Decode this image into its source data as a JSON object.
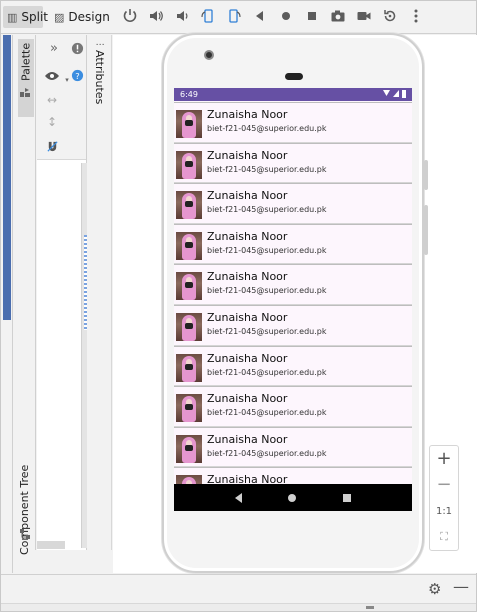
{
  "toolbar": {
    "split_label": "Split",
    "design_label": "Design",
    "tools": [
      "power-icon",
      "volume-up-icon",
      "volume-down-icon",
      "rotate-left-icon",
      "rotate-right-icon",
      "back-icon",
      "home-icon",
      "overview-icon",
      "camera-icon",
      "video-icon",
      "replay-icon",
      "more-icon"
    ]
  },
  "side_tabs": {
    "palette": "Palette",
    "component_tree": "Component Tree",
    "attributes": "Attributes"
  },
  "device": {
    "status_time": "6:49",
    "items": [
      {
        "name": "Zunaisha Noor",
        "email": "biet-f21-045@superior.edu.pk"
      },
      {
        "name": "Zunaisha Noor",
        "email": "biet-f21-045@superior.edu.pk"
      },
      {
        "name": "Zunaisha Noor",
        "email": "biet-f21-045@superior.edu.pk"
      },
      {
        "name": "Zunaisha Noor",
        "email": "biet-f21-045@superior.edu.pk"
      },
      {
        "name": "Zunaisha Noor",
        "email": "biet-f21-045@superior.edu.pk"
      },
      {
        "name": "Zunaisha Noor",
        "email": "biet-f21-045@superior.edu.pk"
      },
      {
        "name": "Zunaisha Noor",
        "email": "biet-f21-045@superior.edu.pk"
      },
      {
        "name": "Zunaisha Noor",
        "email": "biet-f21-045@superior.edu.pk"
      },
      {
        "name": "Zunaisha Noor",
        "email": "biet-f21-045@superior.edu.pk"
      },
      {
        "name": "Zunaisha Noor",
        "email": ""
      }
    ]
  },
  "zoom": {
    "zoom_in": "+",
    "zoom_out": "−",
    "actual_size": "1:1"
  },
  "colors": {
    "status_bar": "#6650a4",
    "list_background": "#fdf6fd",
    "avatar_hijab": "#e596cf"
  }
}
